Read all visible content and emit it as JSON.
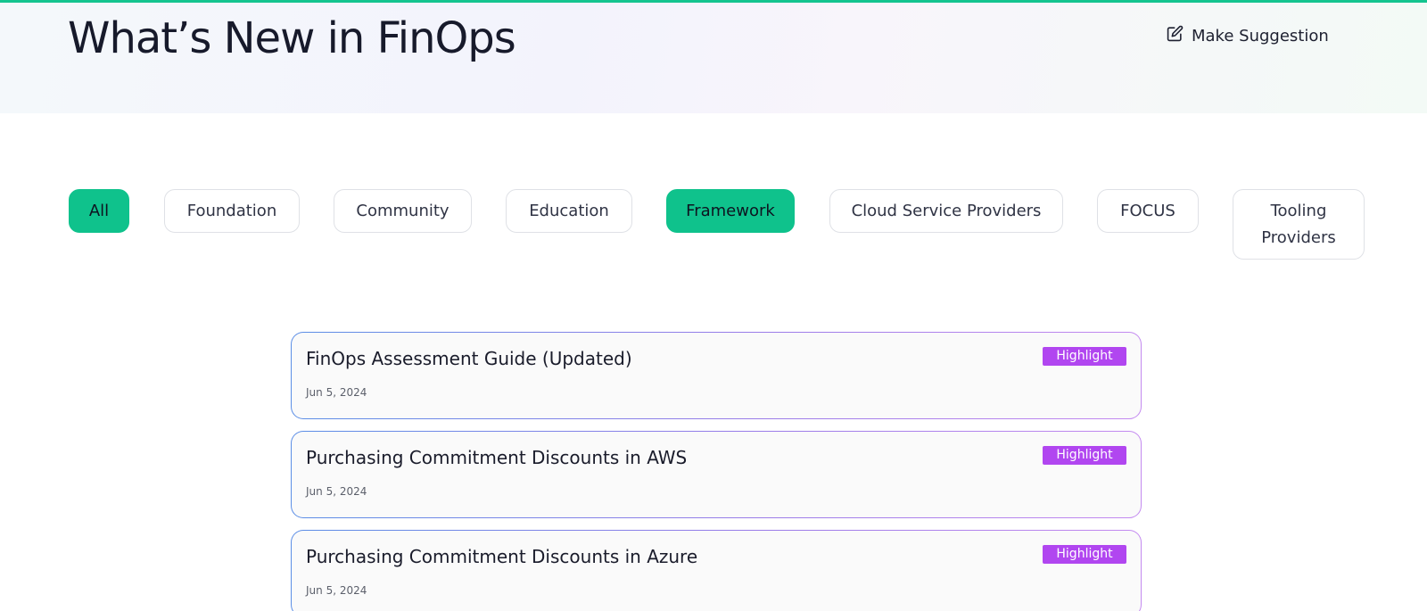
{
  "header": {
    "title": "What’s New in FinOps",
    "suggestion_label": "Make Suggestion"
  },
  "filters": [
    {
      "label": "All",
      "active": true
    },
    {
      "label": "Foundation",
      "active": false
    },
    {
      "label": "Community",
      "active": false
    },
    {
      "label": "Education",
      "active": false
    },
    {
      "label": "Framework",
      "active": true
    },
    {
      "label": "Cloud Service Providers",
      "active": false
    },
    {
      "label": "FOCUS",
      "active": false
    },
    {
      "label": "Tooling Providers",
      "active": false
    }
  ],
  "articles": [
    {
      "title": "FinOps Assessment Guide (Updated)",
      "date": "Jun 5, 2024",
      "badge": "Highlight"
    },
    {
      "title": "Purchasing Commitment Discounts in AWS",
      "date": "Jun 5, 2024",
      "badge": "Highlight"
    },
    {
      "title": "Purchasing Commitment Discounts in Azure",
      "date": "Jun 5, 2024",
      "badge": "Highlight"
    }
  ],
  "colors": {
    "accent": "#0fc28c",
    "badge": "#b146f0"
  },
  "icons": {
    "suggestion": "edit-icon"
  }
}
